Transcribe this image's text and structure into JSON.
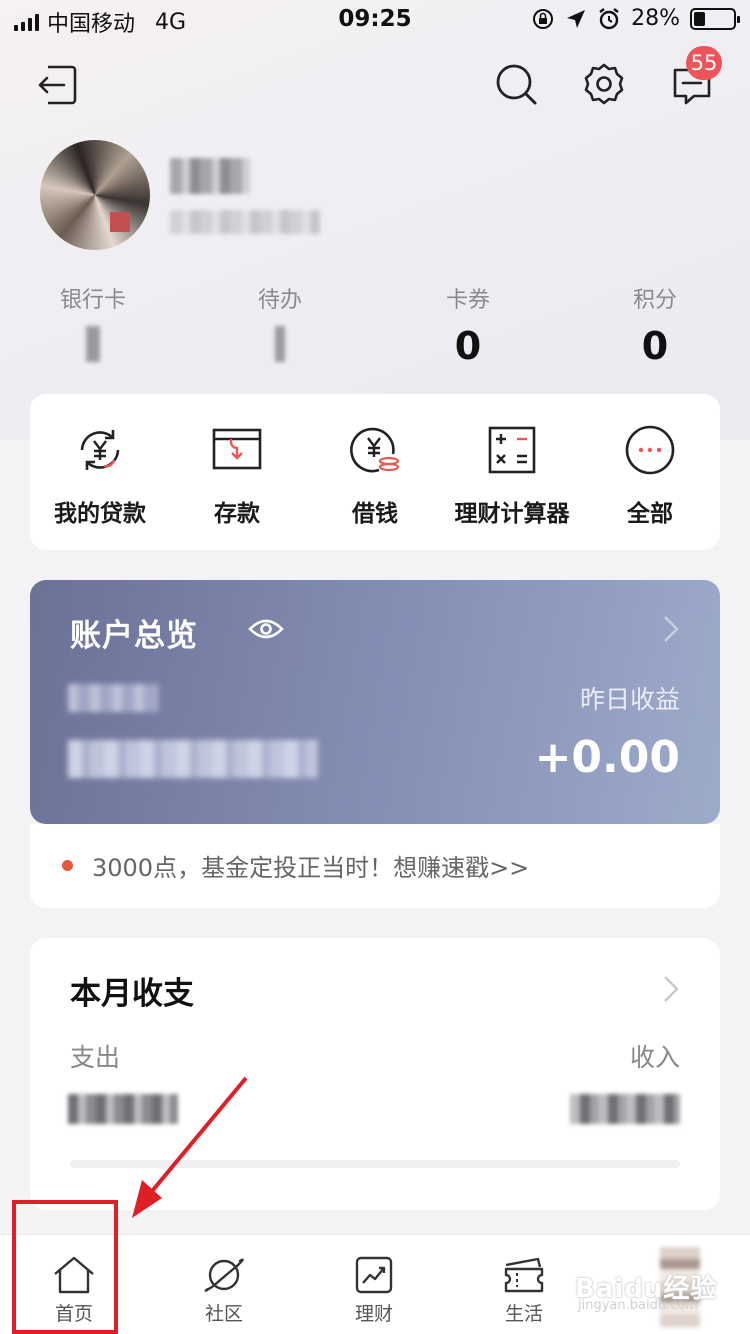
{
  "status_bar": {
    "carrier": "中国移动",
    "network": "4G",
    "time": "09:25",
    "battery": "28%",
    "battery_level": 0.28
  },
  "header": {
    "message_badge": "55",
    "icons": [
      "exit-icon",
      "search-icon",
      "gear-icon",
      "message-icon"
    ]
  },
  "stats": [
    {
      "label": "银行卡",
      "value": ""
    },
    {
      "label": "待办",
      "value": ""
    },
    {
      "label": "卡券",
      "value": "0"
    },
    {
      "label": "积分",
      "value": "0"
    }
  ],
  "quick_actions": [
    {
      "label": "我的贷款",
      "icon": "loan-icon"
    },
    {
      "label": "存款",
      "icon": "deposit-icon"
    },
    {
      "label": "借钱",
      "icon": "borrow-icon"
    },
    {
      "label": "理财计算器",
      "icon": "calculator-icon"
    },
    {
      "label": "全部",
      "icon": "more-icon"
    }
  ],
  "overview": {
    "title": "账户总览",
    "yesterday_label": "昨日收益",
    "yesterday_value": "+0.00",
    "colors": {
      "start": "#6c7196",
      "end": "#9dabca"
    }
  },
  "promo": {
    "text": "3000点，基金定投正当时！想赚速戳>>",
    "dot_color": "#e35a3b"
  },
  "monthly": {
    "title": "本月收支",
    "expense_label": "支出",
    "income_label": "收入"
  },
  "tabbar": {
    "tabs": [
      {
        "label": "首页",
        "icon": "home-icon"
      },
      {
        "label": "社区",
        "icon": "planet-icon"
      },
      {
        "label": "理财",
        "icon": "chart-icon"
      },
      {
        "label": "生活",
        "icon": "ticket-icon"
      }
    ]
  },
  "watermark": {
    "text": "Baidu经验",
    "sub": "jingyan.baidu.com"
  },
  "accent": "#e01e25"
}
